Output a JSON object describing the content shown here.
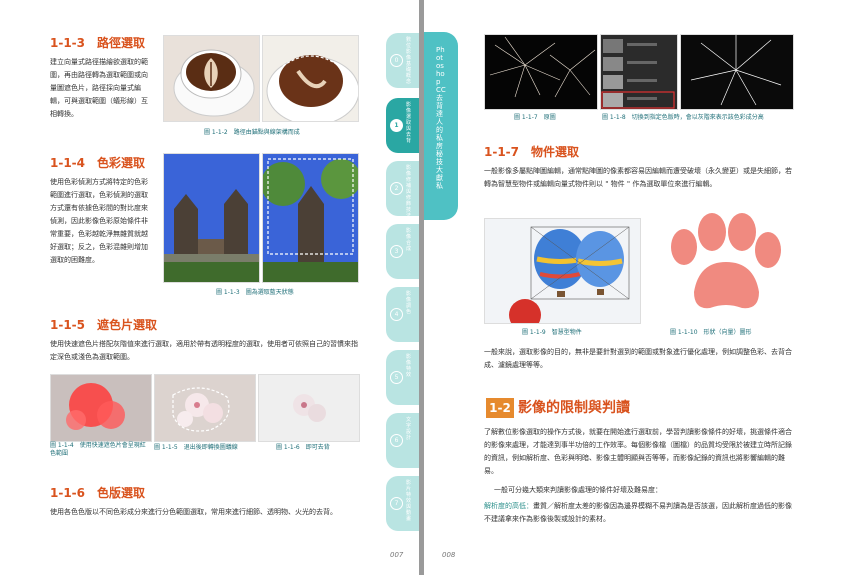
{
  "left_page": {
    "s113": {
      "title": "1-1-3　路徑選取",
      "body": "建立向量式路徑描繪欲選取的範圍，再由路徑轉為選取範圍或向量圖遮色片，路徑採向量式編輯，可與選取範圍（蟻形線）互相轉換。",
      "caption": "圖 1-1-2　路徑由錨點與線架構而成"
    },
    "s114": {
      "title": "1-1-4　色彩選取",
      "body": "使用色彩偵測方式將特定的色彩範圍進行選取，色彩偵測的選取方式還有依據色彩間的對比度來偵測，因此影像色彩原始條件非常重要，色彩越乾淨無雜質就越好選取；反之，色彩混雜則增加選取的困難度。",
      "caption": "圖 1-1-3　圖為選取藍天狀態"
    },
    "s115": {
      "title": "1-1-5　遮色片選取",
      "body": "使用快速遮色片搭配灰階值來進行選取，適用於帶有透明程度的選取，使用者可依照自己的習慣來指定深色或淺色為選取範圍。",
      "cap1": "圖 1-1-4　使用快速遮色片會呈現紅色範圍",
      "cap2": "圖 1-1-5　退出後即轉換圖蟻線",
      "cap3": "圖 1-1-6　即可去背"
    },
    "s116": {
      "title": "1-1-6　色版選取",
      "body": "使用各色色版以不同色彩成分來進行分色範圍選取，常用來進行細節、透明物、火光的去背。"
    },
    "page_number": "007",
    "tabs": [
      {
        "num": "0",
        "label": "數位影像基礎概念"
      },
      {
        "num": "1",
        "label": "影像選取與去背"
      },
      {
        "num": "2",
        "label": "影像修補與修飾技法"
      },
      {
        "num": "3",
        "label": "影像合成"
      },
      {
        "num": "4",
        "label": "影像調色"
      },
      {
        "num": "5",
        "label": "影像特效"
      },
      {
        "num": "6",
        "label": "文字設計"
      },
      {
        "num": "7",
        "label": "影片特效與動畫"
      }
    ]
  },
  "right_page": {
    "chapter_tab": "Photoshop CC 去背達人的私房秘技大獻私",
    "cap17": "圖 1-1-7　原圖",
    "cap18": "圖 1-1-8　切換到指定色版時，會以灰階來表示該色彩成分高",
    "s117": {
      "title": "1-1-7　物件選取",
      "body": "一般影像多屬點陣圖編輯，通常點陣圖的像素都容易因編輯而遭受破壞（永久變更）或是失細節，若轉為智慧型物件或編輯向量式物件則以 \" 物件 \" 作為選取單位來進行編輯。"
    },
    "cap19": "圖 1-1-9　智慧型物件",
    "cap110": "圖 1-1-10　形狀（向量）圖形",
    "after": "一般來說，選取影像的目的，無非是要針對選到的範圍或對象進行優化處理，例如調整色彩、去背合成、濾鏡處理等等。",
    "section": {
      "num": "1-2",
      "title": "影像的限制與判讀"
    },
    "p1": "了解數位影像選取的操作方式後，就要在開始進行選取前，學習判讀影像條件的好壞，挑選條件適合的影像來處理，才能達到事半功倍的工作效率。每個影像檔（圖檔）的品質均受限於被建立時所記錄的資訊，例如解析度、色彩與明暗、影像主體明顯與否等等，而影像紀錄的資訊也將影響編輯的難易。",
    "p2": "一般可分幾大類來判讀影像處理的條件好壞及難易度：",
    "p3_label": "解析度的高低：",
    "p3": "畫質／解析度太差的影像因為邊界模糊不易判讀為是否該選，因此解析度過低的影像不建議拿來作為影像後製或設計的素材。",
    "page_number": "008"
  }
}
